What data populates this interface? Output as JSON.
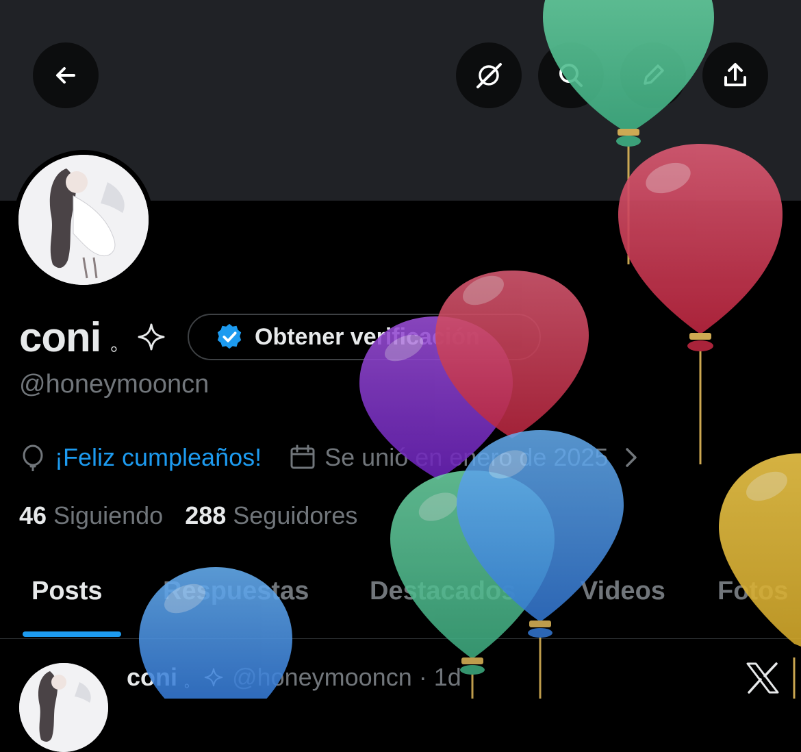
{
  "profile": {
    "display_name": "coni",
    "name_suffix": "。",
    "handle": "@honeymooncn",
    "verify_label": "Obtener verificación",
    "birthday": "¡Feliz cumpleaños!",
    "joined": "Se unió en enero de 2025",
    "following_count": "46",
    "following_label": "Siguiendo",
    "followers_count": "288",
    "followers_label": "Seguidores"
  },
  "tabs": [
    {
      "label": "Posts",
      "active": true
    },
    {
      "label": "Respuestas",
      "active": false
    },
    {
      "label": "Destacados",
      "active": false
    },
    {
      "label": "Videos",
      "active": false
    },
    {
      "label": "Fotos",
      "active": false
    }
  ],
  "post": {
    "name": "coni",
    "name_suffix": "。",
    "handle": "@honeymooncn",
    "separator": "·",
    "time": "1d"
  },
  "icons": {
    "back": "back-arrow-icon",
    "grok": "grok-icon",
    "search": "search-icon",
    "edit": "pencil-icon",
    "share": "share-icon",
    "verified": "verified-badge-icon",
    "birthday": "balloon-icon",
    "calendar": "calendar-icon",
    "x_logo": "x-logo-icon"
  },
  "colors": {
    "accent": "#1d9bf0",
    "background": "#000000",
    "banner": "#202226",
    "muted": "#71767b"
  }
}
